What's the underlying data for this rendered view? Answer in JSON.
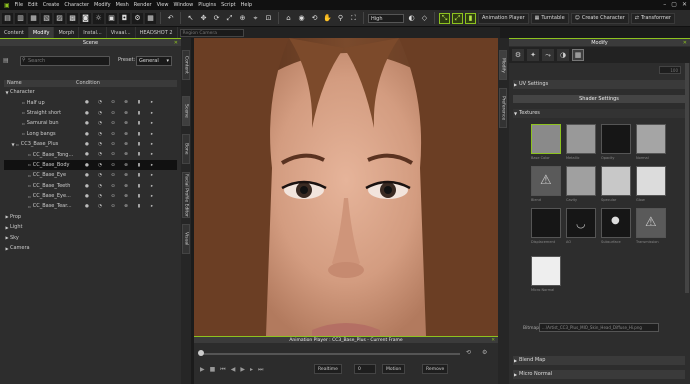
{
  "menu": [
    "File",
    "Edit",
    "Create",
    "Character",
    "Modify",
    "Mesh",
    "Render",
    "View",
    "Window",
    "Plugins",
    "Script",
    "Help"
  ],
  "toolbar": {
    "quality": "High",
    "animation_player": "Animation Player",
    "turntable": "Turntable",
    "create_character": "Create Character",
    "transformer": "Transformer"
  },
  "tabs": [
    {
      "label": "Content"
    },
    {
      "label": "Modify"
    },
    {
      "label": "Morph"
    },
    {
      "label": "Instal..."
    },
    {
      "label": "Vivaal..."
    },
    {
      "label": "HEADSHOT 2"
    },
    {
      "label": "Region Camera"
    }
  ],
  "scene": {
    "title": "Scene",
    "search_placeholder": "Search",
    "preset_label": "Preset:",
    "preset_value": "General",
    "col_name": "Name",
    "col_condition": "Condition",
    "rows": [
      {
        "label": "Character",
        "indent": 0,
        "caret": "▼",
        "icons": false,
        "sel": false
      },
      {
        "label": "Half up",
        "indent": 2,
        "caret": "",
        "icons": true,
        "sel": false
      },
      {
        "label": "Straight short",
        "indent": 2,
        "caret": "",
        "icons": true,
        "sel": false
      },
      {
        "label": "Samurai bun",
        "indent": 2,
        "caret": "",
        "icons": true,
        "sel": false
      },
      {
        "label": "Long bangs",
        "indent": 2,
        "caret": "",
        "icons": true,
        "sel": false
      },
      {
        "label": "CC3_Base_Plus",
        "indent": 1,
        "caret": "▼",
        "icons": true,
        "sel": false
      },
      {
        "label": "CC_Base_Tong...",
        "indent": 3,
        "caret": "",
        "icons": true,
        "sel": false
      },
      {
        "label": "CC_Base_Body",
        "indent": 3,
        "caret": "",
        "icons": true,
        "sel": true
      },
      {
        "label": "CC_Base_Eye",
        "indent": 3,
        "caret": "",
        "icons": true,
        "sel": false
      },
      {
        "label": "CC_Base_Teeth",
        "indent": 3,
        "caret": "",
        "icons": true,
        "sel": false
      },
      {
        "label": "CC_Base_Eye...",
        "indent": 3,
        "caret": "",
        "icons": true,
        "sel": false
      },
      {
        "label": "CC_Base_Tear...",
        "indent": 3,
        "caret": "",
        "icons": true,
        "sel": false
      },
      {
        "label": "Prop",
        "indent": 0,
        "caret": "▶",
        "icons": false,
        "sel": false
      },
      {
        "label": "Light",
        "indent": 0,
        "caret": "▶",
        "icons": false,
        "sel": false
      },
      {
        "label": "Sky",
        "indent": 0,
        "caret": "▶",
        "icons": false,
        "sel": false
      },
      {
        "label": "Camera",
        "indent": 0,
        "caret": "▶",
        "icons": false,
        "sel": false
      }
    ]
  },
  "left_side_tabs": [
    "Content",
    "Scene",
    "Bone",
    "Facial Profile Editor",
    "Visual"
  ],
  "right_side_tabs": [
    "Modify",
    "Preference"
  ],
  "anim_player": {
    "title": "Animation Player : CC3_Base_Plus - Current Frame",
    "frame_value": "0",
    "motion": "Motion",
    "remove": "Remove",
    "realtime": "Realtime"
  },
  "modify": {
    "title": "Modify",
    "uv_settings": "UV Settings",
    "shader_settings": "Shader Settings",
    "textures": "Textures",
    "texture_labels": [
      "Base Color",
      "Metallic",
      "Opacity",
      "Normal",
      "Blend",
      "Cavity",
      "Specular",
      "Glow",
      "Displacement",
      "AO",
      "Subsurface",
      "Transmission",
      "Micro Normal"
    ],
    "bitmap_label": "Bitmap",
    "bitmap_path": "...\\Artist_CC3_Plus_MIO_Skin_Head_Diffuse_Hi.png",
    "blend_map": "Blend Map",
    "micro_normal": "Micro Normal",
    "spinner_value": "100"
  },
  "colors": {
    "accent": "#8dc21f",
    "panel": "#2d2d2d",
    "header": "#3b3b3b"
  }
}
